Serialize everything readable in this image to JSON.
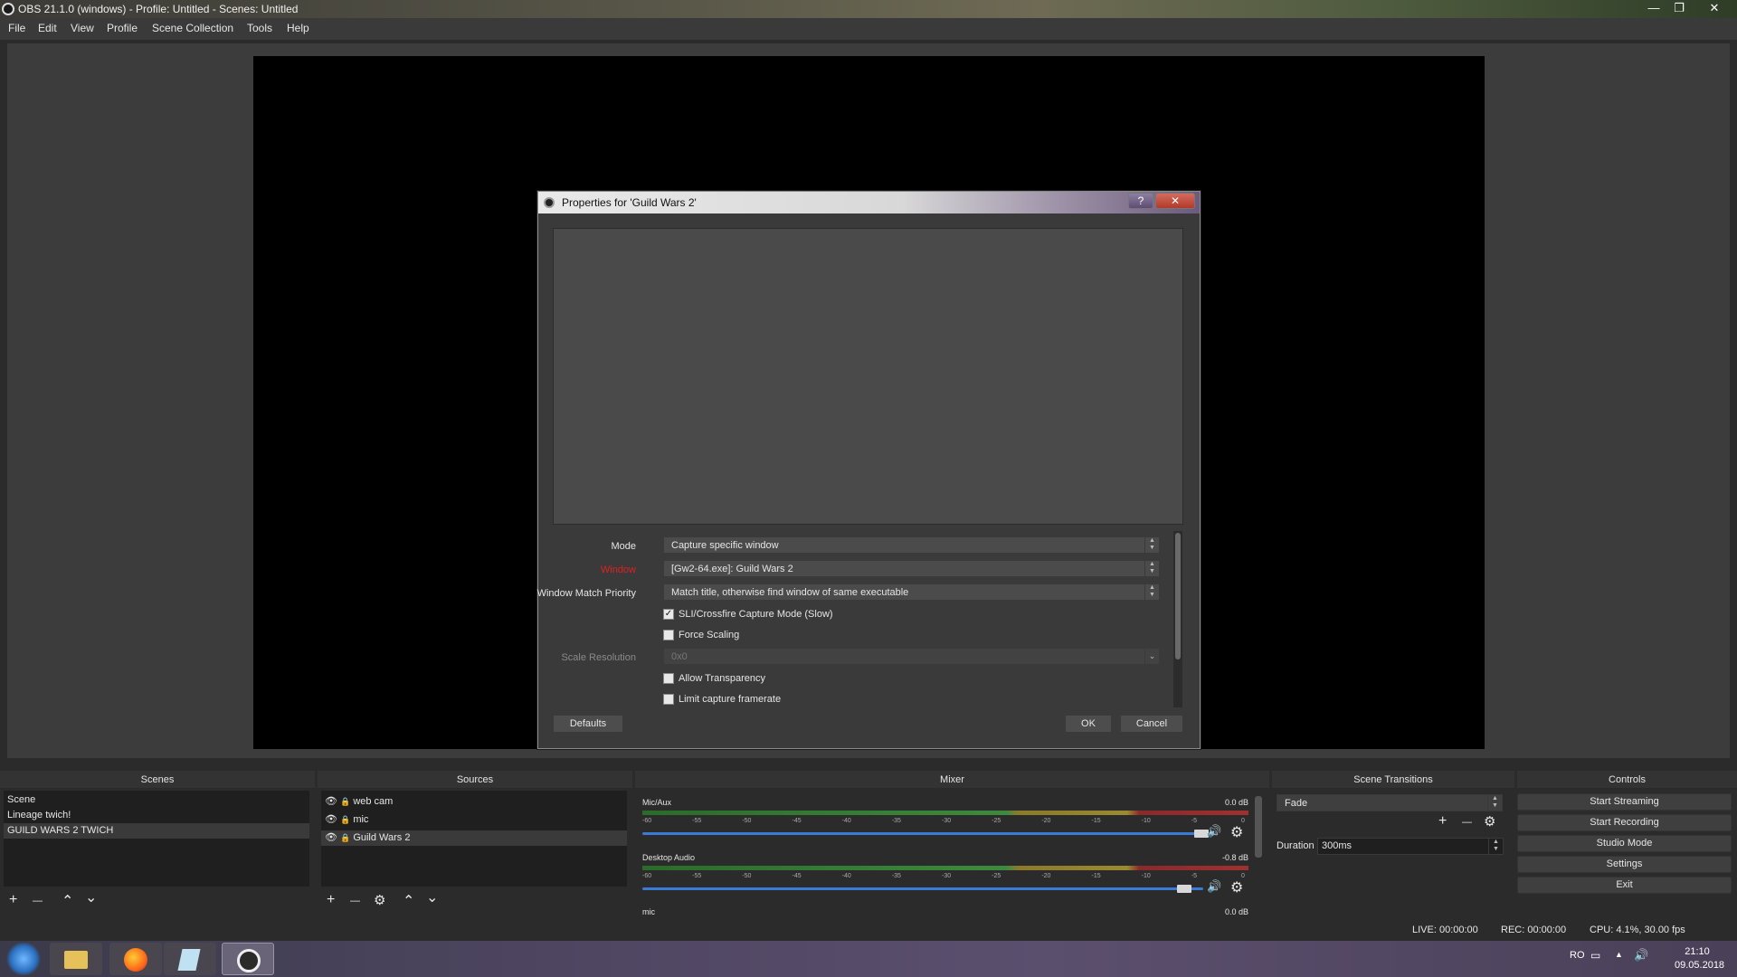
{
  "window": {
    "title": "OBS 21.1.0 (windows) - Profile: Untitled - Scenes: Untitled",
    "controls": {
      "minimize": "—",
      "maximize": "❐",
      "close": "✕"
    }
  },
  "menu": [
    "File",
    "Edit",
    "View",
    "Profile",
    "Scene Collection",
    "Tools",
    "Help"
  ],
  "dialog": {
    "title": "Properties for 'Guild Wars 2'",
    "help_label": "?",
    "close_label": "✕",
    "mode_label": "Mode",
    "mode_value": "Capture specific window",
    "window_label": "Window",
    "window_label_color": "#e02020",
    "window_value": "[Gw2-64.exe]: Guild Wars 2",
    "priority_label": "Window Match Priority",
    "priority_value": "Match title, otherwise find window of same executable",
    "sli_label": "SLI/Crossfire Capture Mode (Slow)",
    "sli_checked": true,
    "force_scaling_label": "Force Scaling",
    "force_scaling_checked": false,
    "scale_res_label": "Scale Resolution",
    "scale_res_value": "0x0",
    "allow_transparency_label": "Allow Transparency",
    "allow_transparency_checked": false,
    "limit_framerate_label": "Limit capture framerate",
    "limit_framerate_checked": false,
    "defaults_label": "Defaults",
    "ok_label": "OK",
    "cancel_label": "Cancel"
  },
  "docks": {
    "scenes_title": "Scenes",
    "sources_title": "Sources",
    "mixer_title": "Mixer",
    "transitions_title": "Scene Transitions",
    "controls_title": "Controls"
  },
  "scenes": [
    "Scene",
    "Lineage twich!",
    "GUILD WARS 2 TWICH"
  ],
  "selected_scene": "GUILD WARS 2 TWICH",
  "sources": [
    "web cam",
    "mic",
    "Guild Wars 2"
  ],
  "selected_source": "Guild Wars 2",
  "toolbar_glyphs": {
    "add": "+",
    "remove": "—",
    "up": "⌃",
    "down": "⌄",
    "settings": "⚙"
  },
  "mixer": {
    "tick_labels": [
      "-60",
      "-55",
      "-50",
      "-45",
      "-40",
      "-35",
      "-30",
      "-25",
      "-20",
      "-15",
      "-10",
      "-5",
      "0"
    ],
    "channels": [
      {
        "name": "Mic/Aux",
        "db": "0.0 dB",
        "volume": 1.0
      },
      {
        "name": "Desktop Audio",
        "db": "-0.8 dB",
        "volume": 0.97
      },
      {
        "name": "mic",
        "db": "0.0 dB",
        "volume": 1.0
      }
    ],
    "speaker_icon": "🔊",
    "gear_icon": "⚙"
  },
  "transitions": {
    "current": "Fade",
    "duration_label": "Duration",
    "duration_value": "300ms"
  },
  "controls": [
    "Start Streaming",
    "Start Recording",
    "Studio Mode",
    "Settings",
    "Exit"
  ],
  "status": {
    "live": "LIVE: 00:00:00",
    "rec": "REC: 00:00:00",
    "cpu": "CPU: 4.1%, 30.00 fps"
  },
  "taskbar": {
    "lang": "RO",
    "time": "21:10",
    "date": "09.05.2018"
  },
  "colors": {
    "accent_blue": "#3a7bd5",
    "required_red": "#e02020"
  }
}
